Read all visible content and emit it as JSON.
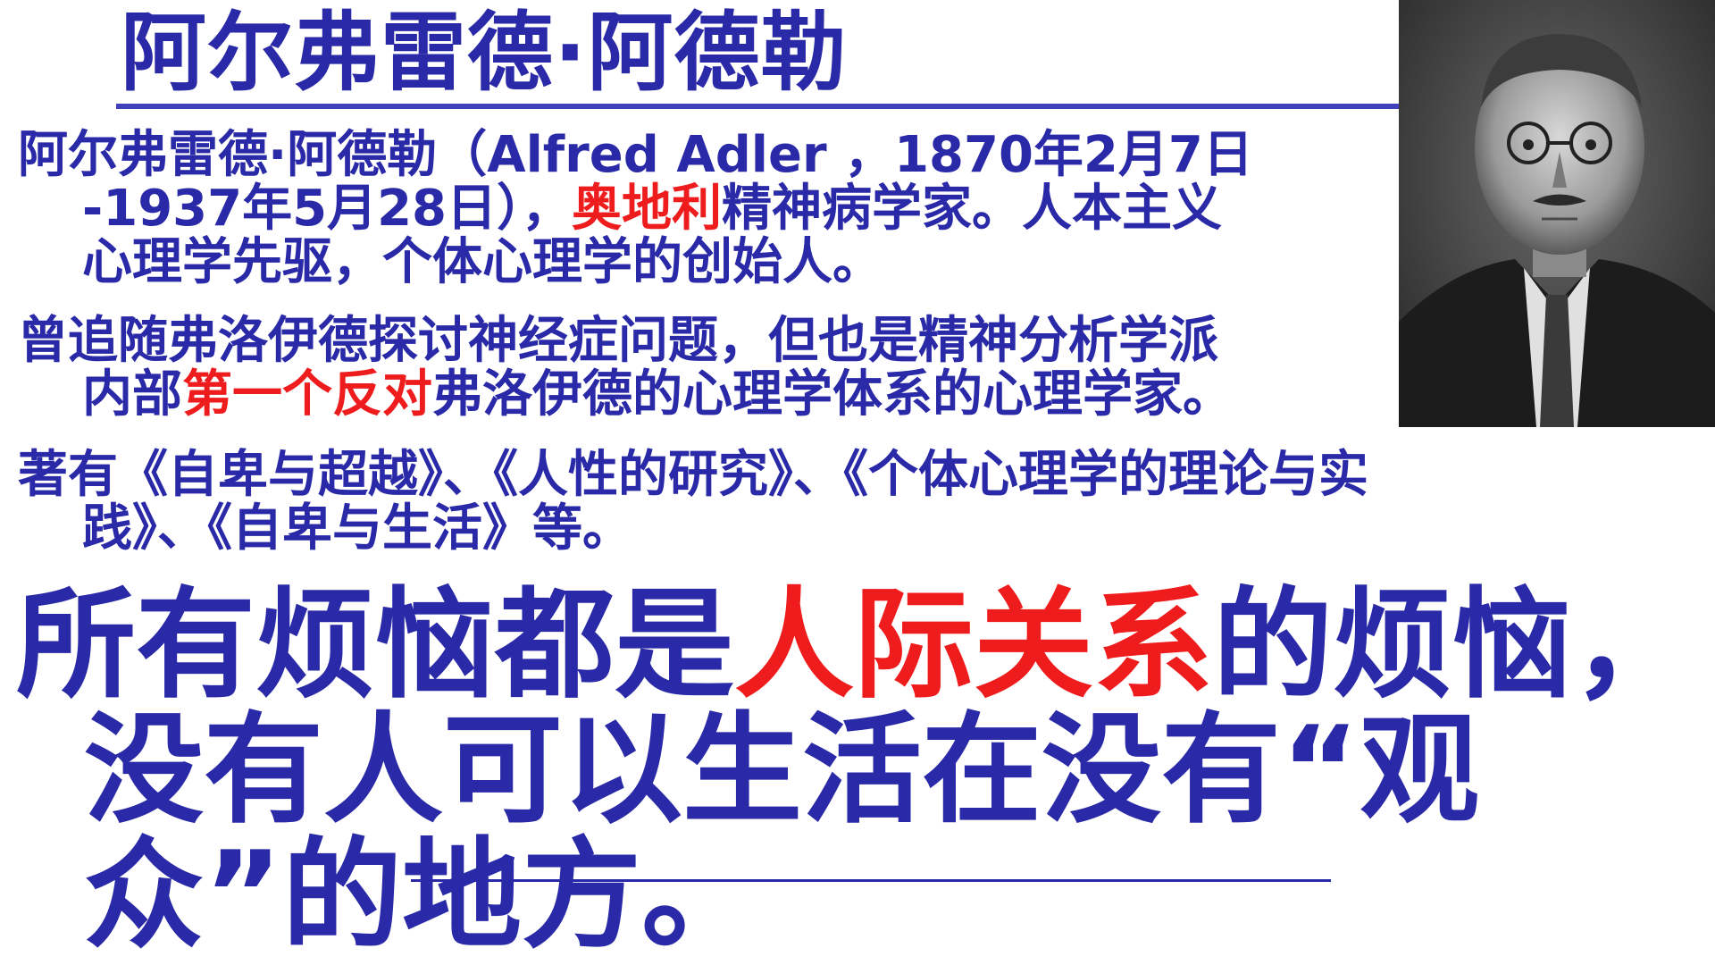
{
  "title": "阿尔弗雷德·阿德勒",
  "portrait": {
    "description_icon": "portrait-photo"
  },
  "paragraph1": {
    "line1": "阿尔弗雷德·阿德勒（Alfred Adler ，1870年2月7日",
    "line2_a": "-1937年5月28日），",
    "line2_red": "奥地利",
    "line2_b": "精神病学家。人本主义",
    "line3": "心理学先驱，个体心理学的创始人。"
  },
  "paragraph2": {
    "line1": "曾追随弗洛伊德探讨神经症问题，但也是精神分析学派",
    "line2_a": "内部",
    "line2_red1": "第一个",
    "line2_red2": "反对",
    "line2_b": "弗洛伊德的心理学体系的心理学家。"
  },
  "paragraph3": {
    "line1": "著有《自卑与超越》、《人性的研究》、《个体心理学的理论与实",
    "line2": "践》、《自卑与生活》等。"
  },
  "quote": {
    "line1_a": "所有烦恼都是",
    "line1_red": "人际关系",
    "line1_b": "的烦恼，",
    "line2": "没有人可以生活在没有“观",
    "line3": "众”的地方。"
  },
  "colors": {
    "text": "#2a2aa8",
    "highlight": "#ee1c1c",
    "background": "#ffffff"
  }
}
